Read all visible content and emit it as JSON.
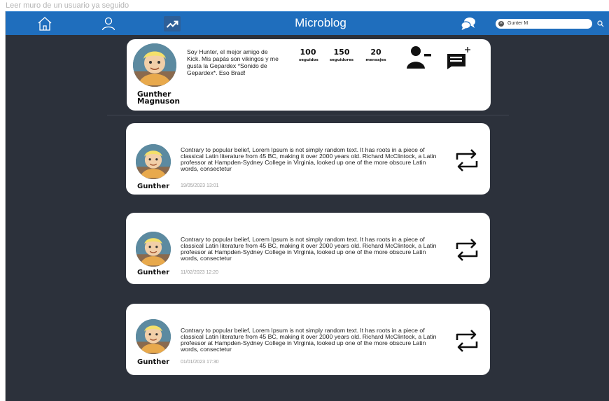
{
  "caption": "Leer muro de un usuario ya seguido",
  "navbar": {
    "brand": "Microblog",
    "icons": [
      "home-icon",
      "user-icon",
      "trending-icon",
      "chat-bubbles-icon",
      "search-icon",
      "clear-icon"
    ],
    "search": {
      "value": "Gunter M"
    },
    "color": "#1f6ebd"
  },
  "profile": {
    "name": "Gunther Magnuson",
    "bio": "Soy Hunter, el mejor amigo de Kick. Mis papás son vikingos y me gusta la Gepardex *Sonido de Gepardex*. Eso Brad!",
    "stats": [
      {
        "value": "100",
        "label": "seguidos"
      },
      {
        "value": "150",
        "label": "seguidores"
      },
      {
        "value": "20",
        "label": "mensajes"
      }
    ],
    "actions": [
      "unfollow-icon",
      "new-message-icon"
    ]
  },
  "posts": [
    {
      "author": "Gunther",
      "text": "Contrary to popular belief, Lorem Ipsum is not simply random text. It has roots in a piece of classical Latin literature from 45 BC, making it over 2000 years old. Richard McClintock, a Latin professor at Hampden-Sydney College in Virginia, looked up one of the more obscure Latin words, consectetur",
      "date": "19/05/2023 13:01"
    },
    {
      "author": "Gunther",
      "text": "Contrary to popular belief, Lorem Ipsum is not simply random text. It has roots in a piece of classical Latin literature from 45 BC, making it over 2000 years old. Richard McClintock, a Latin professor at Hampden-Sydney College in Virginia, looked up one of the more obscure Latin words, consectetur",
      "date": "11/02/2023 12:20"
    },
    {
      "author": "Gunther",
      "text": "Contrary to popular belief, Lorem Ipsum is not simply random text. It has roots in a piece of classical Latin literature from 45 BC, making it over 2000 years old. Richard McClintock, a Latin professor at Hampden-Sydney College in Virginia, looked up one of the more obscure Latin words, consectetur",
      "date": "01/01/2023 17:30"
    }
  ]
}
